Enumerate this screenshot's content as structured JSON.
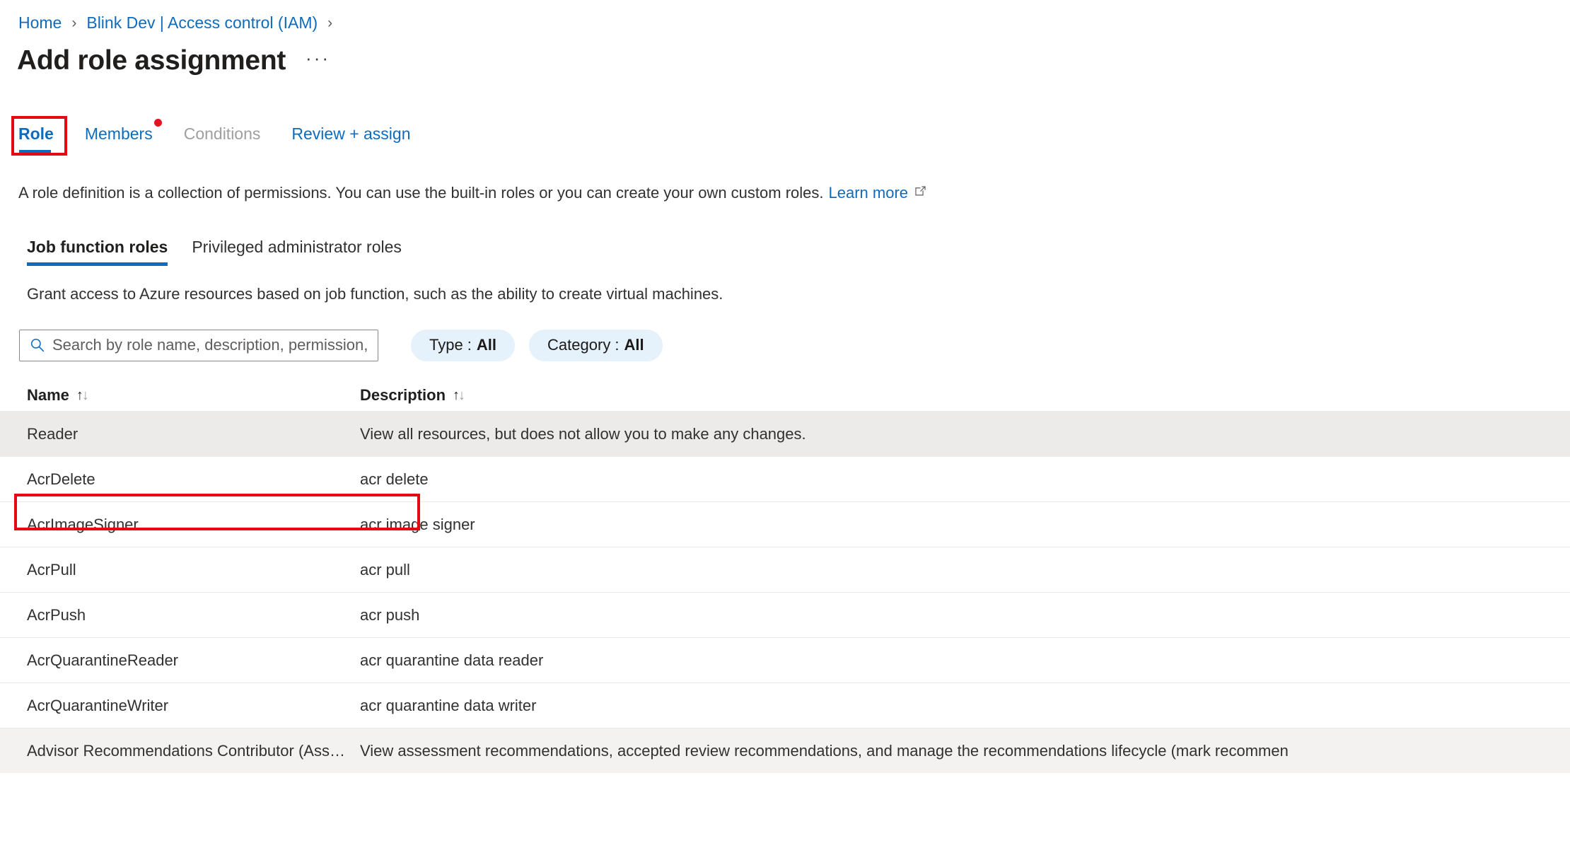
{
  "breadcrumb": {
    "items": [
      {
        "label": "Home"
      },
      {
        "label": "Blink Dev | Access control (IAM)"
      }
    ],
    "separator": "›"
  },
  "header": {
    "title": "Add role assignment",
    "more_menu": "···"
  },
  "wizard": {
    "tabs": [
      {
        "label": "Role",
        "state": "active"
      },
      {
        "label": "Members",
        "state": "enabled",
        "badge": "required-dot"
      },
      {
        "label": "Conditions",
        "state": "disabled"
      },
      {
        "label": "Review + assign",
        "state": "enabled"
      }
    ]
  },
  "role_pane": {
    "description": "A role definition is a collection of permissions. You can use the built-in roles or you can create your own custom roles.",
    "learn_more_label": "Learn more",
    "learn_more_icon": "external-link-icon",
    "pivots": [
      {
        "label": "Job function roles",
        "state": "active"
      },
      {
        "label": "Privileged administrator roles",
        "state": "enabled"
      }
    ],
    "pivot_description": "Grant access to Azure resources based on job function, such as the ability to create virtual machines."
  },
  "toolbar": {
    "search": {
      "icon": "search-icon",
      "value": "",
      "placeholder": "Search by role name, description, permission, or ID"
    },
    "filters": [
      {
        "key": "Type :",
        "value": "All"
      },
      {
        "key": "Category :",
        "value": "All"
      }
    ]
  },
  "table": {
    "columns": [
      {
        "label": "Name",
        "sort_icon": "sort-ascending-descending-icon"
      },
      {
        "label": "Description",
        "sort_icon": "sort-ascending-descending-icon"
      }
    ],
    "sort_up": "↑",
    "sort_down": "↓",
    "rows": [
      {
        "name": "Reader",
        "description": "View all resources, but does not allow you to make any changes.",
        "state": "selected"
      },
      {
        "name": "AcrDelete",
        "description": "acr delete",
        "state": "normal"
      },
      {
        "name": "AcrImageSigner",
        "description": "acr image signer",
        "state": "normal"
      },
      {
        "name": "AcrPull",
        "description": "acr pull",
        "state": "normal"
      },
      {
        "name": "AcrPush",
        "description": "acr push",
        "state": "normal"
      },
      {
        "name": "AcrQuarantineReader",
        "description": "acr quarantine data reader",
        "state": "normal"
      },
      {
        "name": "AcrQuarantineWriter",
        "description": "acr quarantine data writer",
        "state": "normal"
      },
      {
        "name": "Advisor Recommendations Contributor (Assessments a…",
        "description": "View assessment recommendations, accepted review recommendations, and manage the recommendations lifecycle (mark recommen",
        "state": "shaded"
      }
    ]
  },
  "annotations": {
    "accent_red": "#e50914",
    "role_tab_highlight": "Role",
    "reader_row_highlight": "Reader"
  },
  "colors": {
    "link_blue": "#0f6cbd",
    "pill_bg": "#e5f1fb",
    "selected_row_bg": "#edebe9",
    "badge_red": "#e81123",
    "text": "#323130"
  }
}
